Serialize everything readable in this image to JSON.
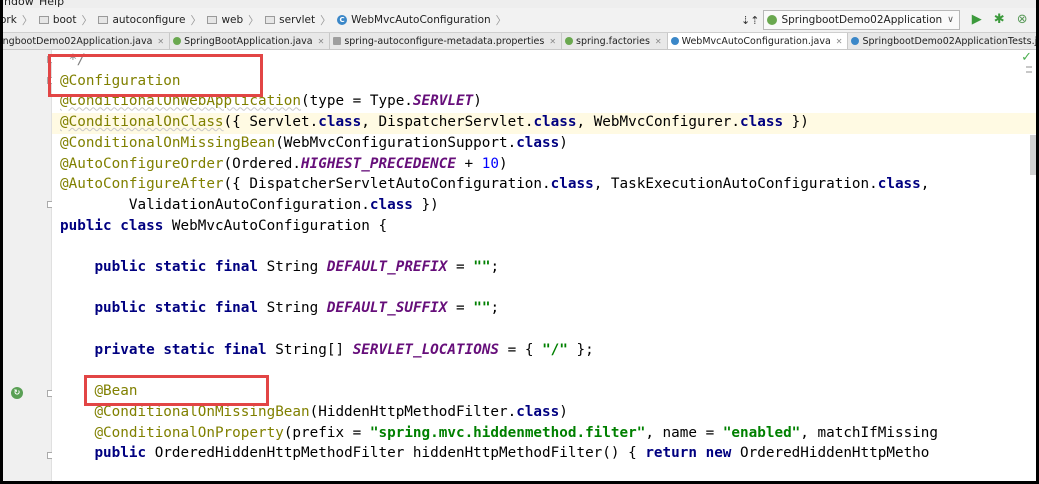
{
  "menu": [
    "indow",
    "Help"
  ],
  "breadcrumbs": [
    {
      "label": "ork",
      "icon": "folder-icon"
    },
    {
      "label": "boot",
      "icon": "folder-icon"
    },
    {
      "label": "autoconfigure",
      "icon": "folder-icon"
    },
    {
      "label": "web",
      "icon": "folder-icon"
    },
    {
      "label": "servlet",
      "icon": "folder-icon"
    },
    {
      "label": "WebMvcAutoConfiguration",
      "icon": "class-icon"
    }
  ],
  "run_config": "SpringbootDemo02Application",
  "tabs": [
    {
      "label": "ingbootDemo02Application.java",
      "icon_color": "#3b87c8",
      "active": false
    },
    {
      "label": "SpringBootApplication.java",
      "icon_color": "#6aa84f",
      "active": false
    },
    {
      "label": "spring-autoconfigure-metadata.properties",
      "icon_color": "#9e9e9e",
      "active": false
    },
    {
      "label": "spring.factories",
      "icon_color": "#6aa84f",
      "active": false
    },
    {
      "label": "WebMvcAutoConfiguration.java",
      "icon_color": "#3b87c8",
      "active": true
    },
    {
      "label": "SpringbootDemo02ApplicationTests.java",
      "icon_color": "#3b87c8",
      "active": false
    }
  ],
  "colors": {
    "keyword": "#000080",
    "annotation": "#808000",
    "string": "#008000",
    "constant": "#660e7a",
    "number": "#0000ff",
    "comment": "#808080",
    "marker": "#e24545",
    "highlight_line": "#fffae3"
  },
  "code": {
    "comment_end": " */",
    "configuration": "@Configuration",
    "cond_web_app": "@ConditionalOnWebApplication",
    "cond_web_app_args": "(type = Type.",
    "servlet_const": "SERVLET",
    "close_paren": ")",
    "cond_on_class": "@ConditionalOnClass",
    "cond_on_class_open": "({ Servlet.",
    "kw_class": "class",
    "dispatcher_servlet": ", DispatcherServlet.",
    "webmvc_configurer": ", WebMvcConfigurer.",
    "close_brace_paren": " })",
    "cond_missing_bean": "@ConditionalOnMissingBean",
    "cond_missing_bean_args": "(WebMvcConfigurationSupport.",
    "auto_configure_order": "@AutoConfigureOrder",
    "ordered_prefix": "(Ordered.",
    "highest_precedence": "HIGHEST_PRECEDENCE",
    "plus": " + ",
    "ten": "10",
    "auto_configure_after": "@AutoConfigureAfter",
    "after_args": "({ DispatcherServletAutoConfiguration.",
    "task_execution": ", TaskExecutionAutoConfiguration.",
    "comma": ",",
    "validation_indent": "        ValidationAutoConfiguration.",
    "kw_public": "public",
    "class_decl": " WebMvcAutoConfiguration {",
    "kw_static": "static",
    "kw_final": "final",
    "kw_private": "private",
    "string_type": " String ",
    "string_array_type": " String[] ",
    "default_prefix": "DEFAULT_PREFIX",
    "default_suffix": "DEFAULT_SUFFIX",
    "servlet_locations": "SERVLET_LOCATIONS",
    "assign": " = ",
    "empty_string": "\"\"",
    "semicolon": ";",
    "array_open": "{ ",
    "slash_string": "\"/\"",
    "array_close": " };",
    "bean": "@Bean",
    "missing_bean_hidden": "(HiddenHttpMethodFilter.",
    "cond_on_property": "@ConditionalOnProperty",
    "prefix_arg": "(prefix = ",
    "prefix_value": "\"spring.mvc.hiddenmethod.filter\"",
    "name_arg": ", name = ",
    "name_value": "\"enabled\"",
    "match_arg": ", matchIfMissing",
    "method_sig": " OrderedHiddenHttpMethodFilter hiddenHttpMethodFilter() { ",
    "kw_return": "return",
    "kw_new": "new",
    "ordered_new": " OrderedHiddenHttpMetho"
  }
}
